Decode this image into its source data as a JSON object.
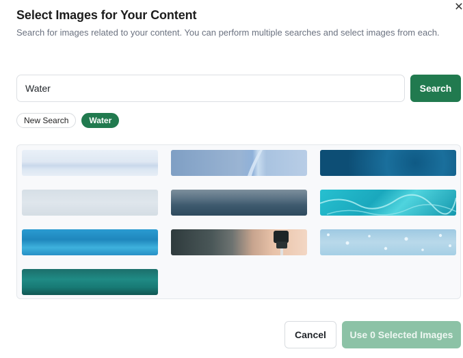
{
  "dialog": {
    "title": "Select Images for Your Content",
    "close_icon": "close-icon",
    "description": "Search for images related to your content. You can perform multiple searches and select images from each."
  },
  "search": {
    "value": "Water",
    "button_label": "Search"
  },
  "chips": [
    {
      "label": "New Search",
      "active": false
    },
    {
      "label": "Water",
      "active": true
    }
  ],
  "images": [
    {
      "subject": "calm water surface, pale blue"
    },
    {
      "subject": "water splash pouring, blue"
    },
    {
      "subject": "underwater bubbles, deep blue"
    },
    {
      "subject": "misty sea horizon, grey"
    },
    {
      "subject": "ocean waves, dark teal"
    },
    {
      "subject": "pool caustics, turquoise"
    },
    {
      "subject": "rippling water, bright blue"
    },
    {
      "subject": "faucet with running water"
    },
    {
      "subject": "water droplets on glass"
    },
    {
      "subject": "underwater light rays, green"
    }
  ],
  "footer": {
    "cancel_label": "Cancel",
    "use_label": "Use 0 Selected Images"
  },
  "colors": {
    "accent": "#217a4f",
    "accent_disabled": "#8cc2a6"
  }
}
